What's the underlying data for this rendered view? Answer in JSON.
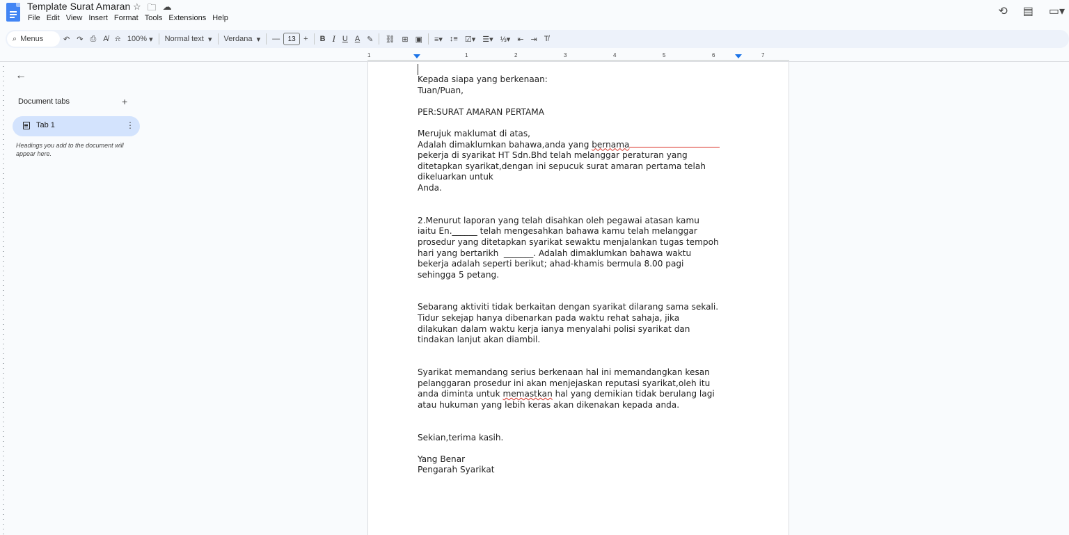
{
  "app": {
    "title": "Template Surat Amaran",
    "menu": [
      "File",
      "Edit",
      "View",
      "Insert",
      "Format",
      "Tools",
      "Extensions",
      "Help"
    ]
  },
  "toolbar": {
    "search_label": "Menus",
    "zoom": "100%",
    "style": "Normal text",
    "font": "Verdana",
    "font_size": "13",
    "bold": "B",
    "italic": "I",
    "underline": "U",
    "text_color": "A"
  },
  "ruler": {
    "numbers": [
      "1",
      "1",
      "2",
      "3",
      "4",
      "5",
      "6",
      "7"
    ]
  },
  "sidebar": {
    "title": "Document tabs",
    "tab_label": "Tab 1",
    "hint": "Headings you add to the document will appear here."
  },
  "document": {
    "greeting": [
      "Kepada siapa yang berkenaan:",
      "Tuan/Puan,"
    ],
    "subject": "PER:SURAT AMARAN PERTAMA",
    "para1": {
      "l1": "Merujuk maklumat di atas,",
      "l2_pre": "Adalah dimaklumkan bahawa,anda yang ",
      "l2_word": "bernama",
      "l3": "pekerja di syarikat HT Sdn.Bhd telah melanggar peraturan yang",
      "l4": "ditetapkan syarikat,dengan ini sepucuk surat amaran pertama telah",
      "l5": "dikeluarkan untuk",
      "l6": "Anda."
    },
    "para2": [
      "2.Menurut laporan yang telah disahkan oleh pegawai atasan kamu",
      "iaitu En.______ telah mengesahkan bahawa kamu telah melanggar",
      "prosedur yang ditetapkan syarikat sewaktu menjalankan tugas tempoh",
      "hari yang bertarikh  _______. Adalah dimaklumkan bahawa waktu",
      "bekerja adalah seperti berikut; ahad-khamis bermula 8.00 pagi",
      "sehingga 5 petang."
    ],
    "para3": [
      "Sebarang aktiviti tidak berkaitan dengan syarikat dilarang sama sekali.",
      "Tidur sekejap hanya dibenarkan pada waktu rehat sahaja, jika",
      "dilakukan dalam waktu kerja ianya menyalahi polisi syarikat dan",
      "tindakan lanjut akan diambil."
    ],
    "para4": {
      "l1": "Syarikat memandang serius berkenaan hal ini memandangkan kesan",
      "l2": "pelanggaran prosedur ini akan menjejaskan reputasi syarikat,oleh itu",
      "l3_pre": "anda diminta untuk ",
      "l3_word": "memastkan",
      "l3_post": " hal yang demikian tidak berulang lagi",
      "l4": "atau hukuman yang lebih keras akan dikenakan kepada anda."
    },
    "closing": "Sekian,terima kasih.",
    "signoff": [
      "Yang Benar",
      "Pengarah Syarikat"
    ]
  }
}
